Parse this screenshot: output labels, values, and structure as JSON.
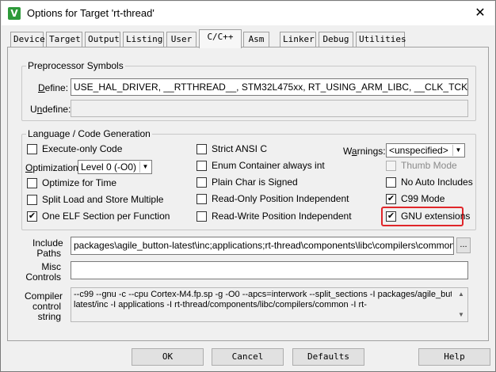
{
  "window": {
    "title": "Options for Target 'rt-thread'",
    "icon_letter": "V",
    "close_glyph": "✕"
  },
  "tabs": [
    {
      "label": "Device"
    },
    {
      "label": "Target"
    },
    {
      "label": "Output"
    },
    {
      "label": "Listing"
    },
    {
      "label": "User"
    },
    {
      "label": "C/C++",
      "active": true
    },
    {
      "label": "Asm"
    },
    {
      "label": "Linker"
    },
    {
      "label": "Debug"
    },
    {
      "label": "Utilities"
    }
  ],
  "preprocessor": {
    "group_label": "Preprocessor Symbols",
    "define_label": "Define:",
    "define_value": "USE_HAL_DRIVER, __RTTHREAD__, STM32L475xx, RT_USING_ARM_LIBC, __CLK_TCK=RT_TICK_PER_SECOND",
    "undefine_label": "Undefine:",
    "undefine_value": ""
  },
  "language": {
    "group_label": "Language / Code Generation",
    "col1": {
      "execute_only": {
        "label": "Execute-only Code",
        "checked": false
      },
      "optimization_label": "Optimization:",
      "optimization_value": "Level 0 (-O0)",
      "optimize_time": {
        "label": "Optimize for Time",
        "checked": false
      },
      "split_load": {
        "label": "Split Load and Store Multiple",
        "checked": false
      },
      "one_elf": {
        "label": "One ELF Section per Function",
        "checked": true
      }
    },
    "col2": {
      "strict_ansi": {
        "label": "Strict ANSI C",
        "checked": false
      },
      "enum_container": {
        "label": "Enum Container always int",
        "checked": false
      },
      "plain_char": {
        "label": "Plain Char is Signed",
        "checked": false
      },
      "ro_pi": {
        "label": "Read-Only Position Independent",
        "checked": false
      },
      "rw_pi": {
        "label": "Read-Write Position Independent",
        "checked": false
      }
    },
    "col3": {
      "warnings_label": "Warnings:",
      "warnings_value": "<unspecified>",
      "thumb_mode": {
        "label": "Thumb Mode",
        "checked": false,
        "disabled": true
      },
      "no_auto_includes": {
        "label": "No Auto Includes",
        "checked": false
      },
      "c99_mode": {
        "label": "C99 Mode",
        "checked": true
      },
      "gnu_extensions": {
        "label": "GNU extensions",
        "checked": true
      }
    }
  },
  "include": {
    "label_line1": "Include",
    "label_line2": "Paths",
    "value": "packages\\agile_button-latest\\inc;applications;rt-thread\\components\\libc\\compilers\\common;rt-thread",
    "browse_label": "..."
  },
  "misc": {
    "label_line1": "Misc",
    "label_line2": "Controls",
    "value": ""
  },
  "compiler": {
    "label_line1": "Compiler",
    "label_line2": "control",
    "label_line3": "string",
    "line1": "--c99 --gnu -c --cpu Cortex-M4.fp.sp -g -O0 --apcs=interwork --split_sections -I packages/agile_button-",
    "line2": "latest/inc -I applications -I rt-thread/components/libc/compilers/common -I rt-"
  },
  "buttons": {
    "ok": "OK",
    "cancel": "Cancel",
    "defaults": "Defaults",
    "help": "Help"
  },
  "glyphs": {
    "check": "✔",
    "dropdown": "▼",
    "scroll_up": "▲",
    "scroll_down": "▼"
  }
}
